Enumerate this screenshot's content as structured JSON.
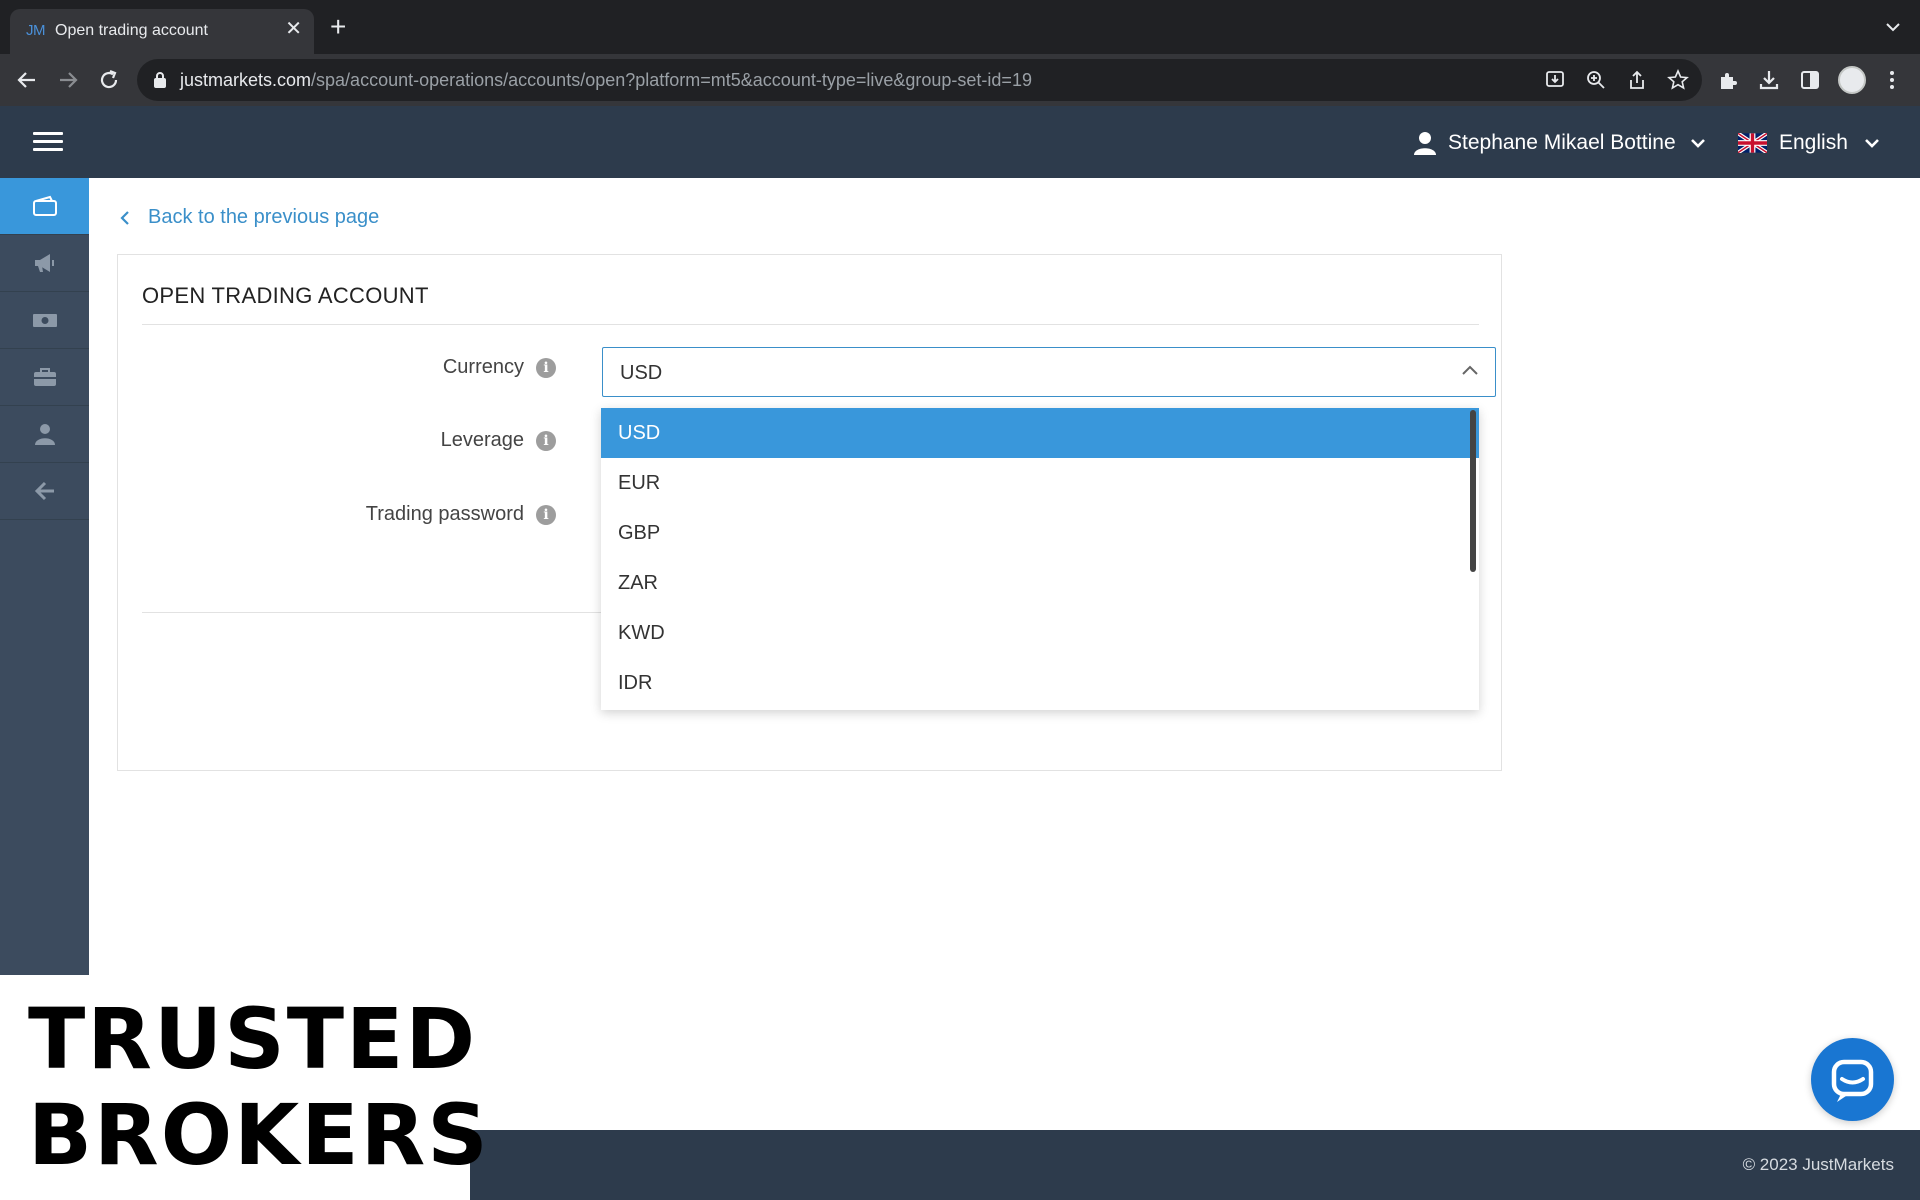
{
  "browser": {
    "tab_favicon": "JM",
    "tab_title": "Open trading account",
    "url_host": "justmarkets.com",
    "url_path": "/spa/account-operations/accounts/open?platform=mt5&account-type=live&group-set-id=19"
  },
  "header": {
    "user_name": "Stephane Mikael Bottine",
    "language": "English"
  },
  "sidebar": {
    "items": [
      {
        "icon": "wallet-icon",
        "active": true
      },
      {
        "icon": "megaphone-icon",
        "active": false
      },
      {
        "icon": "money-icon",
        "active": false
      },
      {
        "icon": "briefcase-icon",
        "active": false
      },
      {
        "icon": "user-icon",
        "active": false
      },
      {
        "icon": "arrow-left-icon",
        "active": false
      }
    ]
  },
  "main": {
    "back_link": "Back to the previous page",
    "card_title": "OPEN TRADING ACCOUNT",
    "fields": {
      "currency_label": "Currency",
      "leverage_label": "Leverage",
      "password_label": "Trading password",
      "currency_value": "USD"
    },
    "currency_options": [
      "USD",
      "EUR",
      "GBP",
      "ZAR",
      "KWD",
      "IDR"
    ]
  },
  "footer": {
    "copyright": "© 2023 JustMarkets"
  },
  "watermark": {
    "line1": "TRUSTED",
    "line2": "BROKERS"
  },
  "colors": {
    "accent": "#3997db",
    "header_bg": "#2d3b4c",
    "sidebar_bg": "#3c4b5e",
    "submit_green": "#27a66a",
    "chat_blue": "#1976d2"
  }
}
